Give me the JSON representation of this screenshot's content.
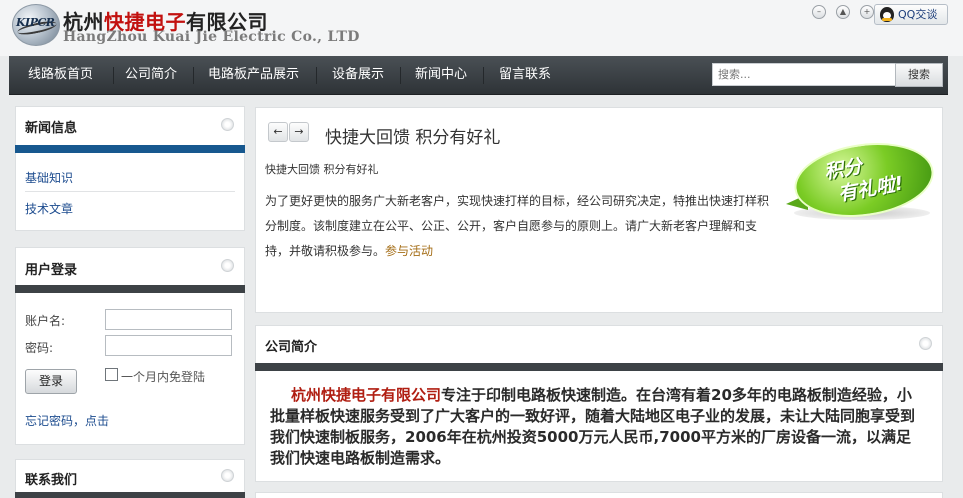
{
  "header": {
    "logo_mark": "KIPCR",
    "company_cn_prefix": "杭州",
    "company_cn_highlight": "快捷电子",
    "company_cn_suffix": "有限公司",
    "company_en": "HangZhou Kuai Jie Electric Co., LTD",
    "qq_label": "QQ交谈"
  },
  "nav": {
    "items": [
      {
        "label": "线路板首页"
      },
      {
        "label": "公司简介"
      },
      {
        "label": "电路板产品展示"
      },
      {
        "label": "设备展示"
      },
      {
        "label": "新闻中心"
      },
      {
        "label": "留言联系"
      }
    ],
    "search_placeholder": "搜索...",
    "search_button": "搜索"
  },
  "sidebar": {
    "news": {
      "title": "新闻信息",
      "links": [
        {
          "label": "基础知识"
        },
        {
          "label": "技术文章"
        }
      ]
    },
    "login": {
      "title": "用户登录",
      "username_label": "账户名:",
      "password_label": "密码:",
      "login_button": "登录",
      "remember_label": "一个月内免登陆",
      "forgot_label": "忘记密码，点击"
    },
    "contact": {
      "title": "联系我们"
    }
  },
  "news": {
    "prev_arrow": "←",
    "next_arrow": "→",
    "title": "快捷大回馈 积分有好礼",
    "subtitle": "快捷大回馈 积分有好礼",
    "body": "为了更好更快的服务广大新老客户，实现快速打样的目标，经公司研究决定，特推出快速打样积分制度。该制度建立在公平、公正、公开，客户自愿参与的原则上。请广大新老客户理解和支持，并敬请积极参与。",
    "link": "参与活动",
    "badge_line1": "积分",
    "badge_line2": "有礼啦!"
  },
  "intro": {
    "title": "公司简介",
    "company_name": "杭州快捷电子有限公司",
    "text": "专注于印制电路板快速制造。在台湾有着20多年的电路板制造经验，小批量样板快速服务受到了广大客户的一致好评，随着大陆地区电子业的发展，未让大陆同胞享受到我们快速制板服务，2006年在杭州投资5000万元人民币,7000平方米的厂房设备一流，以满足我们快速电路板制造需求。"
  },
  "colors": {
    "brand_red": "#c2110f",
    "nav_dark": "#3d4246",
    "accent_blue": "#17588f",
    "badge_green": "#7bcc25",
    "link_blue": "#1d4c8f",
    "link_gold": "#a46d16"
  },
  "icons": {
    "window_controls": [
      "minus-circle-icon",
      "up-circle-icon",
      "plus-circle-icon"
    ],
    "qq": "qq-penguin-icon",
    "panel_dot": "circle-icon"
  }
}
